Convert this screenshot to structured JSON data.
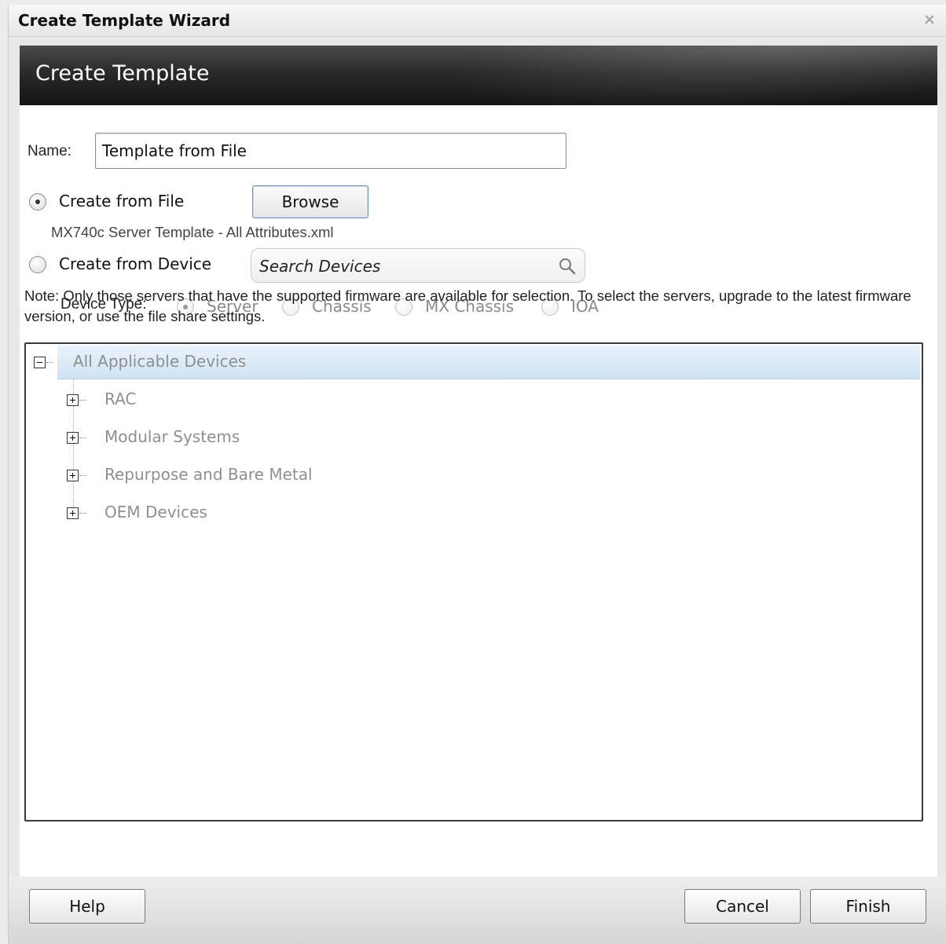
{
  "window": {
    "title": "Create Template Wizard",
    "close_icon": "close-icon"
  },
  "banner": {
    "title": "Create Template"
  },
  "form": {
    "name_label": "Name:",
    "name_value": "Template from File",
    "create_from_file_label": "Create from File",
    "create_from_file_selected": true,
    "browse_label": "Browse",
    "selected_file": "MX740c Server Template - All Attributes.xml",
    "create_from_device_label": "Create from Device",
    "create_from_device_selected": false,
    "search_placeholder": "Search Devices",
    "search_icon": "search-icon",
    "device_type_label": "Device Type:",
    "device_types": [
      {
        "label": "Server",
        "selected": true
      },
      {
        "label": "Chassis",
        "selected": false
      },
      {
        "label": "MX Chassis",
        "selected": false
      },
      {
        "label": "IOA",
        "selected": false
      }
    ],
    "note": "Note: Only those servers that have the supported firmware are available for selection. To select the servers, upgrade to the latest firmware version, or use the file share settings."
  },
  "tree": {
    "root": {
      "label": "All Applicable Devices",
      "expanded": true
    },
    "children": [
      {
        "label": "RAC",
        "expanded": false
      },
      {
        "label": "Modular Systems",
        "expanded": false
      },
      {
        "label": "Repurpose and Bare Metal",
        "expanded": false
      },
      {
        "label": "OEM Devices",
        "expanded": false
      }
    ]
  },
  "footer": {
    "help_label": "Help",
    "cancel_label": "Cancel",
    "finish_label": "Finish"
  },
  "colors": {
    "banner_dark": "#1a1a1a",
    "tree_selected_row": "#cfe3f5",
    "disabled_text": "#8f8f8f"
  }
}
